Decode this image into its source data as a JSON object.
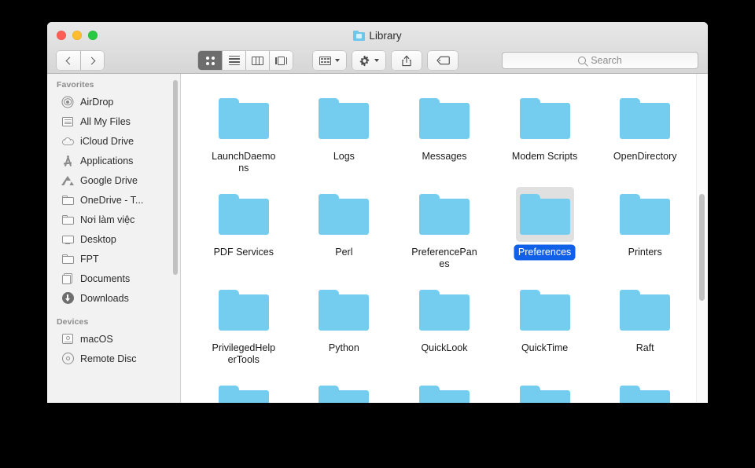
{
  "window": {
    "title": "Library",
    "title_icon": "folder-icon",
    "traffic_lights": [
      {
        "name": "close",
        "color": "#ff5f57"
      },
      {
        "name": "minimize",
        "color": "#febc2e"
      },
      {
        "name": "zoom",
        "color": "#28c840"
      }
    ]
  },
  "toolbar": {
    "back_label": "Back",
    "forward_label": "Forward",
    "view_modes": [
      {
        "name": "icon-view",
        "label": "Icon View",
        "active": true
      },
      {
        "name": "list-view",
        "label": "List View",
        "active": false
      },
      {
        "name": "column-view",
        "label": "Column View",
        "active": false
      },
      {
        "name": "coverflow-view",
        "label": "Cover Flow View",
        "active": false
      }
    ],
    "arrange_label": "Arrange By",
    "action_label": "Action",
    "share_label": "Share",
    "tag_label": "Tags"
  },
  "search": {
    "placeholder": "Search",
    "value": ""
  },
  "sidebar": {
    "sections": [
      {
        "header": "Favorites",
        "items": [
          {
            "label": "AirDrop",
            "icon": "airdrop-icon"
          },
          {
            "label": "All My Files",
            "icon": "all-my-files-icon"
          },
          {
            "label": "iCloud Drive",
            "icon": "icloud-icon"
          },
          {
            "label": "Applications",
            "icon": "applications-icon"
          },
          {
            "label": "Google Drive",
            "icon": "google-drive-icon"
          },
          {
            "label": "OneDrive - T...",
            "icon": "folder-icon"
          },
          {
            "label": "Nơi làm việc",
            "icon": "folder-icon"
          },
          {
            "label": "Desktop",
            "icon": "desktop-icon"
          },
          {
            "label": "FPT",
            "icon": "folder-icon"
          },
          {
            "label": "Documents",
            "icon": "documents-icon"
          },
          {
            "label": "Downloads",
            "icon": "downloads-icon"
          }
        ]
      },
      {
        "header": "Devices",
        "items": [
          {
            "label": "macOS",
            "icon": "hard-disk-icon"
          },
          {
            "label": "Remote Disc",
            "icon": "optical-disc-icon"
          }
        ]
      }
    ]
  },
  "content": {
    "selection_color": "#1160e8",
    "folder_color": "#74cdef",
    "items": [
      {
        "label": "LaunchDaemons",
        "selected": false
      },
      {
        "label": "Logs",
        "selected": false
      },
      {
        "label": "Messages",
        "selected": false
      },
      {
        "label": "Modem Scripts",
        "selected": false
      },
      {
        "label": "OpenDirectory",
        "selected": false
      },
      {
        "label": "PDF Services",
        "selected": false
      },
      {
        "label": "Perl",
        "selected": false
      },
      {
        "label": "PreferencePanes",
        "selected": false
      },
      {
        "label": "Preferences",
        "selected": true
      },
      {
        "label": "Printers",
        "selected": false
      },
      {
        "label": "PrivilegedHelperTools",
        "selected": false
      },
      {
        "label": "Python",
        "selected": false
      },
      {
        "label": "QuickLook",
        "selected": false
      },
      {
        "label": "QuickTime",
        "selected": false
      },
      {
        "label": "Raft",
        "selected": false
      },
      {
        "label": "",
        "selected": false
      },
      {
        "label": "",
        "selected": false
      },
      {
        "label": "",
        "selected": false
      },
      {
        "label": "",
        "selected": false
      },
      {
        "label": "",
        "selected": false
      }
    ]
  }
}
